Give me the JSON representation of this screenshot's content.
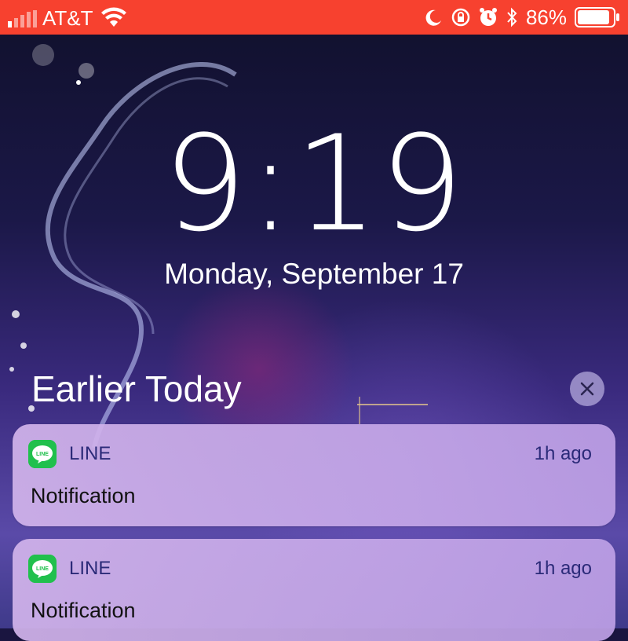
{
  "status_bar": {
    "carrier": "AT&T",
    "battery_percent": "86%",
    "icons": [
      "signal-icon",
      "wifi-icon",
      "moon-icon",
      "rotation-lock-icon",
      "alarm-icon",
      "bluetooth-icon",
      "battery-icon"
    ],
    "background_color": "#f7412f"
  },
  "lock_screen": {
    "time": "9:19",
    "date": "Monday, September 17"
  },
  "notifications_section": {
    "title": "Earlier Today",
    "clear_icon": "close-icon"
  },
  "notifications": [
    {
      "app": "LINE",
      "time_ago": "1h ago",
      "message": "Notification",
      "icon": "line-icon"
    },
    {
      "app": "LINE",
      "time_ago": "1h ago",
      "message": "Notification",
      "icon": "line-icon"
    }
  ]
}
